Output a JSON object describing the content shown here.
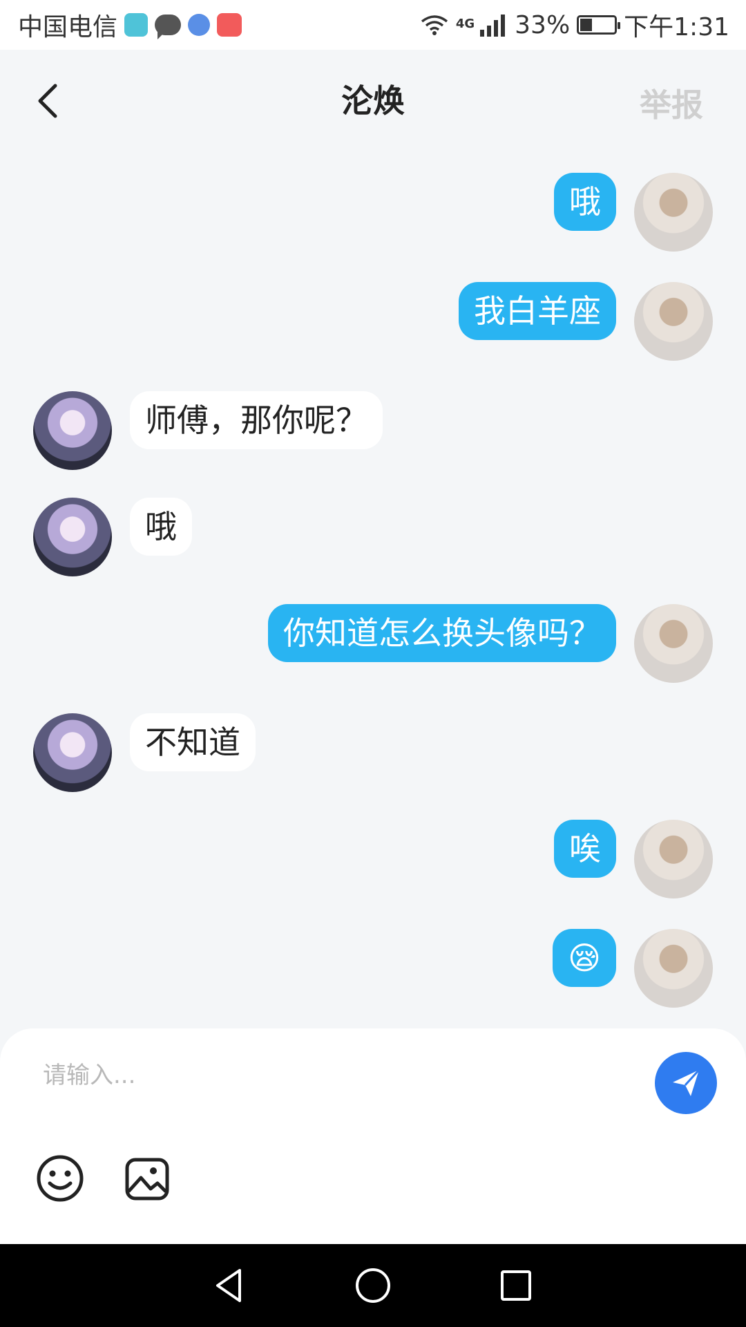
{
  "status_bar": {
    "carrier": "中国电信",
    "network": "4G",
    "battery": "33%",
    "time": "下午1:31"
  },
  "header": {
    "title": "沦焕",
    "report_label": "举报"
  },
  "messages": [
    {
      "from": "me",
      "text": "哦"
    },
    {
      "from": "me",
      "text": "我白羊座"
    },
    {
      "from": "other",
      "text": "师傅，那你呢？"
    },
    {
      "from": "other",
      "text": "哦"
    },
    {
      "from": "me",
      "text": "你知道怎么换头像吗？"
    },
    {
      "from": "other",
      "text": "不知道"
    },
    {
      "from": "me",
      "text": "唉"
    },
    {
      "from": "me",
      "text": "😪"
    }
  ],
  "composer": {
    "placeholder": "请输入...",
    "value": ""
  },
  "colors": {
    "outgoing_bubble": "#29b4f2",
    "incoming_bubble": "#ffffff",
    "send_button": "#2f7cf0",
    "background": "#f4f6f8"
  },
  "icons": [
    "back-icon",
    "send-icon",
    "emoji-icon",
    "image-icon",
    "nav-back-icon",
    "nav-home-icon",
    "nav-recents-icon"
  ]
}
